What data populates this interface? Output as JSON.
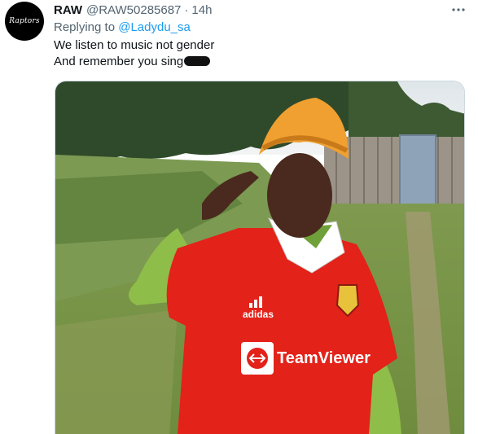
{
  "tweet": {
    "avatar_text": "Raptors",
    "display_name": "RAW",
    "handle": "@RAW50285687",
    "separator": "·",
    "time": "14h",
    "more_icon": "more-dots-icon",
    "replying_prefix": "Replying to",
    "replying_to": "@Ladydu_sa",
    "text_lines": [
      "We listen to music not gender",
      "And remember you sing"
    ],
    "media": {
      "jersey_brand_text": "adidas",
      "sponsor_text": "TeamViewer"
    }
  },
  "colors": {
    "text_primary": "#0f1419",
    "text_secondary": "#536471",
    "link": "#1d9bf0",
    "jersey_red": "#e32219"
  }
}
